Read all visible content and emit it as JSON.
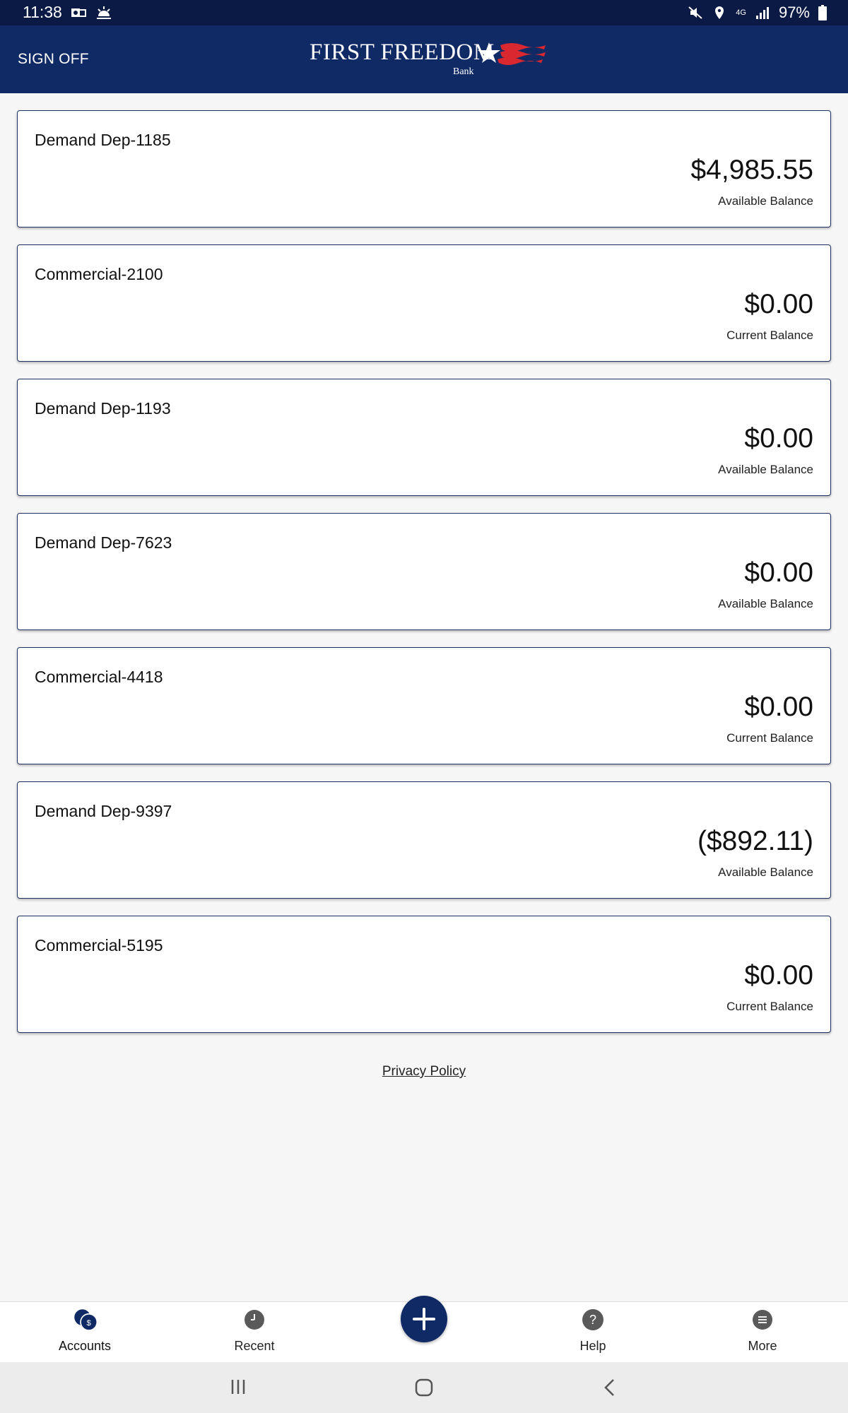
{
  "status_bar": {
    "time": "11:38",
    "network": "4G",
    "battery": "97%",
    "icons": [
      "outlook-icon",
      "weather-icon",
      "mute-icon",
      "location-icon",
      "signal-icon",
      "battery-icon"
    ]
  },
  "header": {
    "sign_off": "SIGN OFF",
    "logo_text": "FIRST FREEDOM",
    "logo_sub": "Bank",
    "brand_color": "#102a65"
  },
  "accounts": [
    {
      "name": "Demand Dep-1185",
      "amount": "$4,985.55",
      "label": "Available Balance"
    },
    {
      "name": "Commercial-2100",
      "amount": "$0.00",
      "label": "Current Balance"
    },
    {
      "name": "Demand Dep-1193",
      "amount": "$0.00",
      "label": "Available Balance"
    },
    {
      "name": "Demand Dep-7623",
      "amount": "$0.00",
      "label": "Available Balance"
    },
    {
      "name": "Commercial-4418",
      "amount": "$0.00",
      "label": "Current Balance"
    },
    {
      "name": "Demand Dep-9397",
      "amount": "($892.11)",
      "label": "Available Balance"
    },
    {
      "name": "Commercial-5195",
      "amount": "$0.00",
      "label": "Current Balance"
    }
  ],
  "footer": {
    "privacy_policy": "Privacy Policy"
  },
  "bottom_nav": {
    "accounts": "Accounts",
    "recent": "Recent",
    "help": "Help",
    "more": "More",
    "help_glyph": "?"
  }
}
